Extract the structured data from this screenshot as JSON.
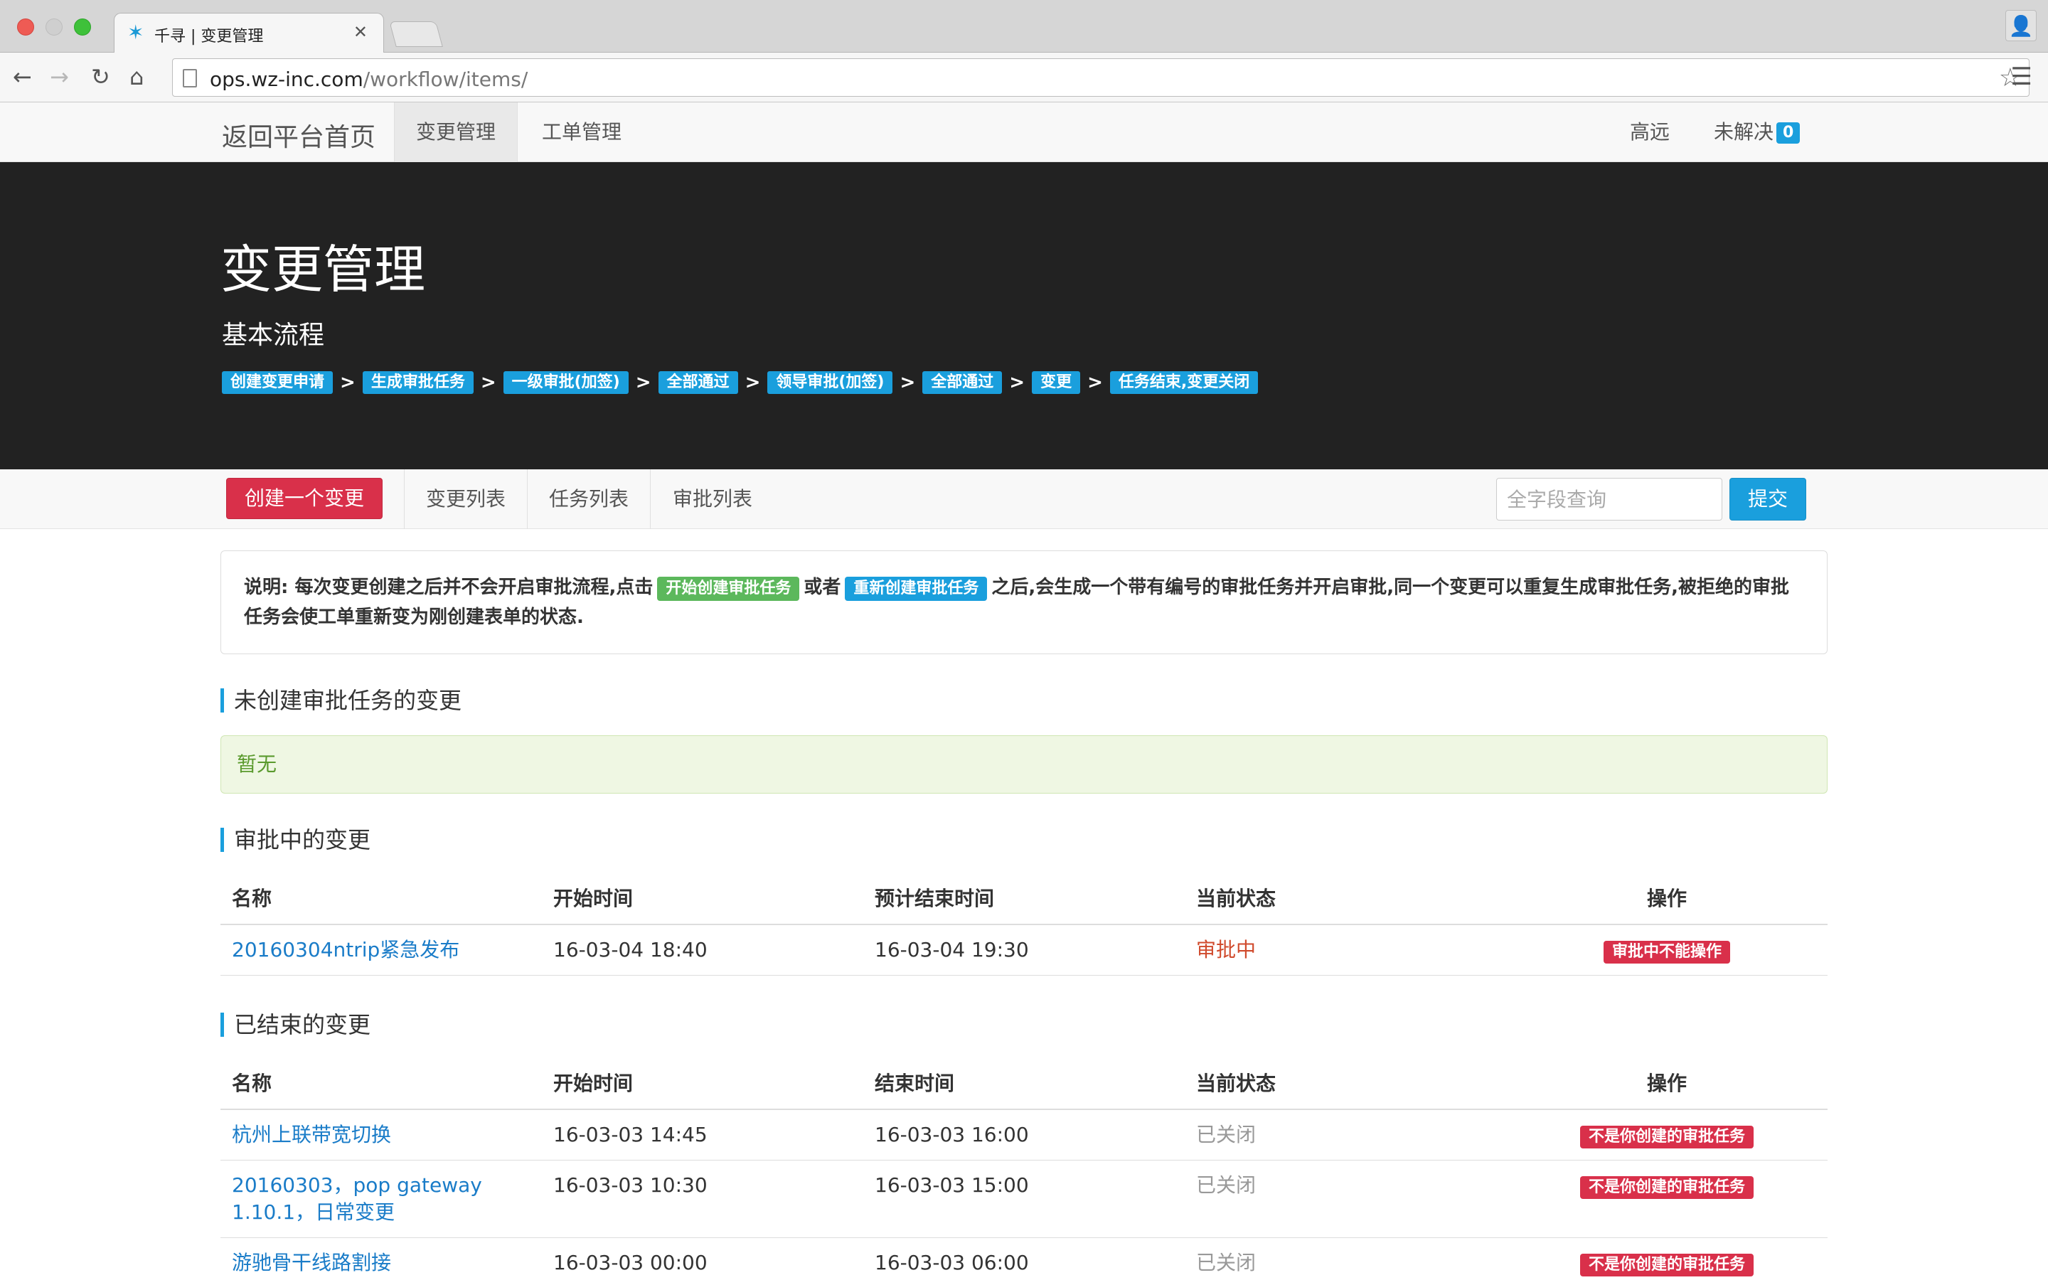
{
  "browser": {
    "tab_title": "千寻 | 变更管理",
    "url_host": "ops.wz-inc.com",
    "url_path": "/workflow/items/"
  },
  "navbar": {
    "brand": "返回平台首页",
    "items": [
      "变更管理",
      "工单管理"
    ],
    "user": "高远",
    "unresolved_label": "未解决",
    "unresolved_count": "0"
  },
  "hero": {
    "title": "变更管理",
    "subtitle": "基本流程",
    "flow": [
      "创建变更申请",
      "生成审批任务",
      "一级审批(加签)",
      "全部通过",
      "领导审批(加签)",
      "全部通过",
      "变更",
      "任务结束,变更关闭"
    ],
    "arrow": ">"
  },
  "subnav": {
    "create_button": "创建一个变更",
    "items": [
      "变更列表",
      "任务列表",
      "审批列表"
    ],
    "search_placeholder": "全字段查询",
    "submit_button": "提交"
  },
  "notice": {
    "part1": "说明: 每次变更创建之后并不会开启审批流程,点击",
    "label_start": "开始创建审批任务",
    "part2": "或者",
    "label_recreate": "重新创建审批任务",
    "part3": "之后,会生成一个带有编号的审批任务并开启审批,同一个变更可以重复生成审批任务,被拒绝的审批任务会使工单重新变为刚创建表单的状态."
  },
  "section_uncreated": {
    "title": "未创建审批任务的变更",
    "empty_text": "暂无"
  },
  "section_pending": {
    "title": "审批中的变更",
    "headers": [
      "名称",
      "开始时间",
      "预计结束时间",
      "当前状态",
      "操作"
    ],
    "rows": [
      {
        "name": "20160304ntrip紧急发布",
        "start": "16-03-04 18:40",
        "end": "16-03-04 19:30",
        "status": "审批中",
        "action": "审批中不能操作"
      }
    ]
  },
  "section_finished": {
    "title": "已结束的变更",
    "headers": [
      "名称",
      "开始时间",
      "结束时间",
      "当前状态",
      "操作"
    ],
    "rows": [
      {
        "name": "杭州上联带宽切换",
        "start": "16-03-03 14:45",
        "end": "16-03-03 16:00",
        "status": "已关闭",
        "action": "不是你创建的审批任务"
      },
      {
        "name": "20160303，pop gateway 1.10.1，日常变更",
        "start": "16-03-03 10:30",
        "end": "16-03-03 15:00",
        "status": "已关闭",
        "action": "不是你创建的审批任务"
      },
      {
        "name": "游驰骨干线路割接",
        "start": "16-03-03 00:00",
        "end": "16-03-03 06:00",
        "status": "已关闭",
        "action": "不是你创建的审批任务"
      }
    ]
  },
  "colors": {
    "primary": "#1a9fdd",
    "danger": "#d9304a",
    "success": "#5cb85c",
    "hero_bg": "#222222"
  }
}
